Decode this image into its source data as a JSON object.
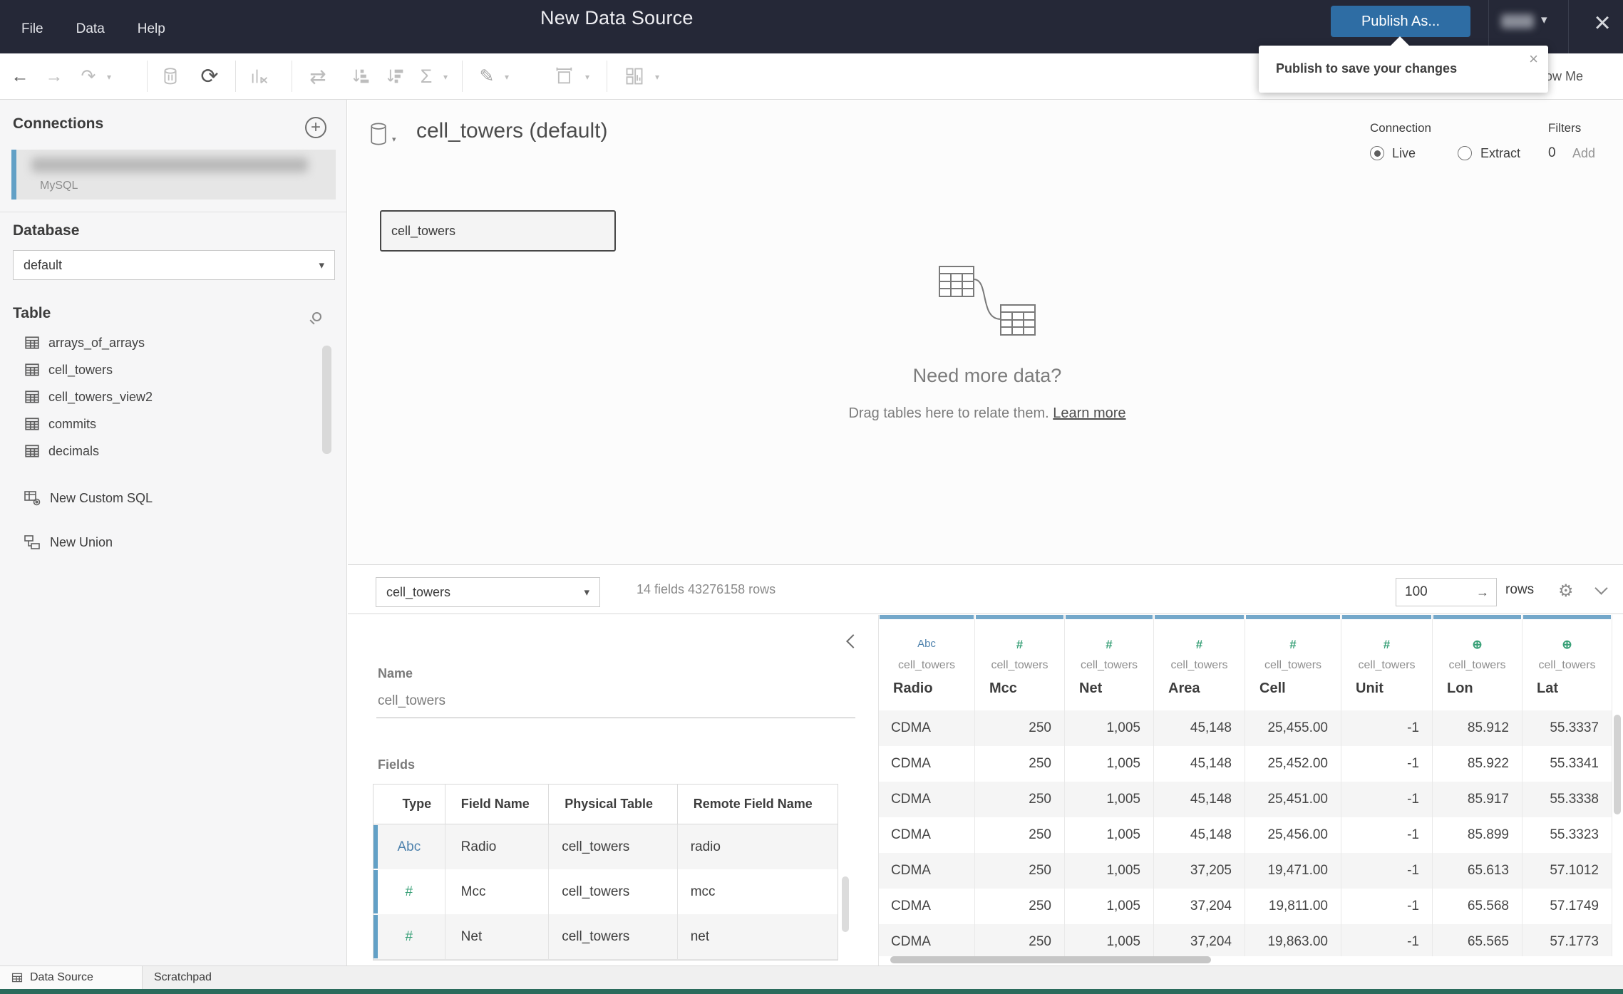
{
  "colors": {
    "titlebar_bg": "#252837",
    "publish_button_blue": "#2e6da4",
    "accent_blue": "#62a0c6",
    "grid_header_blue": "#74a8ca",
    "type_string_blue": "#4e82ad",
    "type_number_green": "#38a077",
    "bottom_strip_teal": "#2a6b5c"
  },
  "titlebar": {
    "menus": [
      {
        "label": "File"
      },
      {
        "label": "Data"
      },
      {
        "label": "Help"
      }
    ],
    "title": "New Data Source",
    "publish_button": "Publish As...",
    "user_caret": "▾",
    "close_glyph": "×"
  },
  "tooltip": {
    "text": "Publish to save your changes",
    "close_glyph": "×"
  },
  "toolbar": {
    "caret": "▾",
    "show_me": "Show Me",
    "icons": {
      "undo": "←",
      "redo": "→",
      "replay": "↷",
      "refresh": "⟳",
      "swap": "⇄",
      "totals": "Σ",
      "highlight": "✎",
      "text_box": "T"
    }
  },
  "sidebar": {
    "connections_title": "Connections",
    "connection": {
      "subtitle": "MySQL"
    },
    "database_title": "Database",
    "database_selected": "default",
    "table_title": "Table",
    "tables": [
      {
        "name": "arrays_of_arrays"
      },
      {
        "name": "cell_towers"
      },
      {
        "name": "cell_towers_view2"
      },
      {
        "name": "commits"
      },
      {
        "name": "decimals"
      }
    ],
    "actions": {
      "new_custom_sql": "New Custom SQL",
      "new_union": "New Union"
    }
  },
  "canvas": {
    "datasource_title": "cell_towers (default)",
    "connection_label": "Connection",
    "live_label": "Live",
    "extract_label": "Extract",
    "filters_label": "Filters",
    "filters_count": "0",
    "filters_add": "Add",
    "table_box_label": "cell_towers",
    "empty_heading": "Need more data?",
    "empty_body": "Drag tables here to relate them. ",
    "empty_link": "Learn more"
  },
  "metabar": {
    "table_selected": "cell_towers",
    "fields_summary": "14 fields 43276158 rows",
    "row_count": "100",
    "row_arrow": "→",
    "rows_label": "rows",
    "gear_glyph": "⚙"
  },
  "metadata_pane": {
    "name_label": "Name",
    "name_value": "cell_towers",
    "fields_label": "Fields",
    "columns": {
      "type": "Type",
      "field": "Field Name",
      "physical": "Physical Table",
      "remote": "Remote Field Name"
    },
    "rows": [
      {
        "icon": "Abc",
        "icon_class": "type-string",
        "field": "Radio",
        "physical": "cell_towers",
        "remote": "radio"
      },
      {
        "icon": "#",
        "icon_class": "type-number",
        "field": "Mcc",
        "physical": "cell_towers",
        "remote": "mcc"
      },
      {
        "icon": "#",
        "icon_class": "type-number",
        "field": "Net",
        "physical": "cell_towers",
        "remote": "net"
      }
    ]
  },
  "grid": {
    "columns": [
      {
        "icon": "Abc",
        "icon_class": "type-string",
        "table": "cell_towers",
        "field": "Radio"
      },
      {
        "icon": "#",
        "icon_class": "type-number",
        "table": "cell_towers",
        "field": "Mcc"
      },
      {
        "icon": "#",
        "icon_class": "type-number",
        "table": "cell_towers",
        "field": "Net"
      },
      {
        "icon": "#",
        "icon_class": "type-number",
        "table": "cell_towers",
        "field": "Area"
      },
      {
        "icon": "#",
        "icon_class": "type-number",
        "table": "cell_towers",
        "field": "Cell"
      },
      {
        "icon": "#",
        "icon_class": "type-number",
        "table": "cell_towers",
        "field": "Unit"
      },
      {
        "icon": "⊕",
        "icon_class": "type-geo",
        "table": "cell_towers",
        "field": "Lon"
      },
      {
        "icon": "⊕",
        "icon_class": "type-geo",
        "table": "cell_towers",
        "field": "Lat"
      }
    ],
    "rows": [
      [
        "CDMA",
        "250",
        "1,005",
        "45,148",
        "25,455.00",
        "-1",
        "85.912",
        "55.3337"
      ],
      [
        "CDMA",
        "250",
        "1,005",
        "45,148",
        "25,452.00",
        "-1",
        "85.922",
        "55.3341"
      ],
      [
        "CDMA",
        "250",
        "1,005",
        "45,148",
        "25,451.00",
        "-1",
        "85.917",
        "55.3338"
      ],
      [
        "CDMA",
        "250",
        "1,005",
        "45,148",
        "25,456.00",
        "-1",
        "85.899",
        "55.3323"
      ],
      [
        "CDMA",
        "250",
        "1,005",
        "37,205",
        "19,471.00",
        "-1",
        "65.613",
        "57.1012"
      ],
      [
        "CDMA",
        "250",
        "1,005",
        "37,204",
        "19,811.00",
        "-1",
        "65.568",
        "57.1749"
      ],
      [
        "CDMA",
        "250",
        "1,005",
        "37,204",
        "19,863.00",
        "-1",
        "65.565",
        "57.1773"
      ]
    ]
  },
  "statusbar": {
    "data_source_tab": "Data Source",
    "scratchpad_tab": "Scratchpad"
  }
}
